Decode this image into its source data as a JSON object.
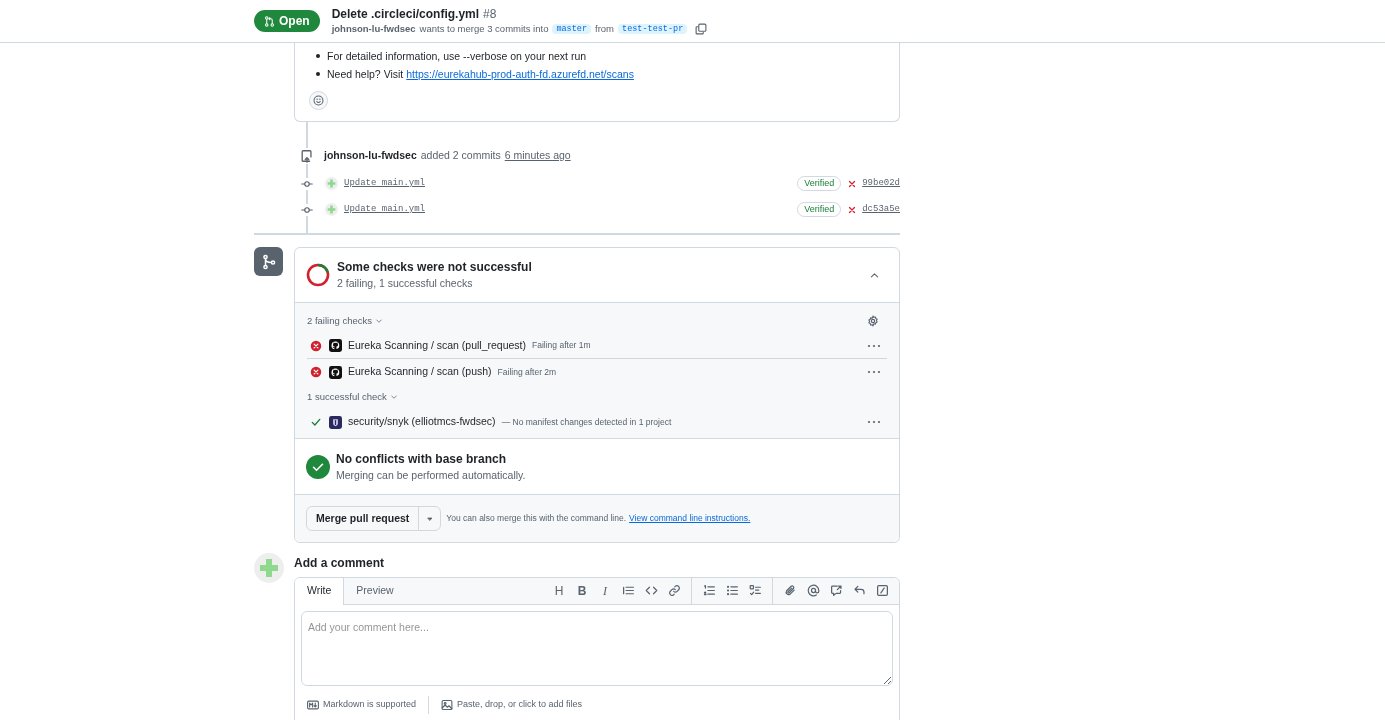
{
  "header": {
    "state": "Open",
    "title": "Delete .circleci/config.yml",
    "number": "#8",
    "author": "johnson-lu-fwdsec",
    "merge_text": "wants to merge 3 commits into",
    "base": "master",
    "from_text": "from",
    "head": "test-test-pr"
  },
  "comment": {
    "bullets": [
      {
        "text": "For detailed information, use --verbose on your next run"
      },
      {
        "text": "Need help? Visit",
        "link": "https://eurekahub-prod-auth-fd.azurefd.net/scans"
      }
    ]
  },
  "event": {
    "author": "johnson-lu-fwdsec",
    "action": "added 2 commits",
    "time": "6 minutes ago"
  },
  "commits": [
    {
      "message": "Update main.yml",
      "badge": "Verified",
      "kind": "failed",
      "sha": "99be02d"
    },
    {
      "message": "Update main.yml",
      "badge": "Verified",
      "kind": "failed",
      "sha": "dc53a5e"
    }
  ],
  "checks": {
    "title": "Some checks were not successful",
    "summary": "2 failing, 1 successful checks",
    "expanded": true,
    "groups": [
      {
        "label": "2 failing checks",
        "items": [
          {
            "kind": "failing",
            "app": {
              "kind": "github"
            },
            "name": "Eureka Scanning / scan (pull_request)",
            "detail": "Failing after 1m"
          },
          {
            "kind": "failing",
            "app": {
              "kind": "github"
            },
            "name": "Eureka Scanning / scan (push)",
            "detail": "Failing after 2m"
          }
        ]
      },
      {
        "label": "1 successful check",
        "items": [
          {
            "kind": "success",
            "app": {
              "kind": "snyk"
            },
            "name": "security/snyk (elliotmcs-fwdsec)",
            "detail": "— No manifest changes detected in 1 project"
          }
        ]
      }
    ]
  },
  "merge": {
    "title": "No conflicts with base branch",
    "subtitle": "Merging can be performed automatically.",
    "button": "Merge pull request",
    "hint": "You can also merge this with the command line.",
    "link": "View command line instructions."
  },
  "add_comment": {
    "title": "Add a comment",
    "tabs": [
      {
        "label": "Write",
        "selected": true
      },
      {
        "label": "Preview",
        "selected": false
      }
    ],
    "toolbar": [
      [
        {
          "kind": "glyph",
          "label": "H"
        },
        {
          "kind": "glyph",
          "label": "B"
        },
        {
          "kind": "glyph",
          "label": "I"
        },
        {
          "kind": "quote"
        },
        {
          "kind": "code"
        },
        {
          "kind": "link"
        }
      ],
      [
        {
          "kind": "numbered"
        },
        {
          "kind": "bulleted"
        },
        {
          "kind": "tasks"
        }
      ],
      [
        {
          "kind": "attach"
        },
        {
          "kind": "mention"
        },
        {
          "kind": "crossref"
        },
        {
          "kind": "reply"
        },
        {
          "kind": "slash"
        }
      ]
    ],
    "placeholder": "Add your comment here...",
    "markdown_note": "Markdown is supported",
    "files_note": "Paste, drop, or click to add files"
  }
}
